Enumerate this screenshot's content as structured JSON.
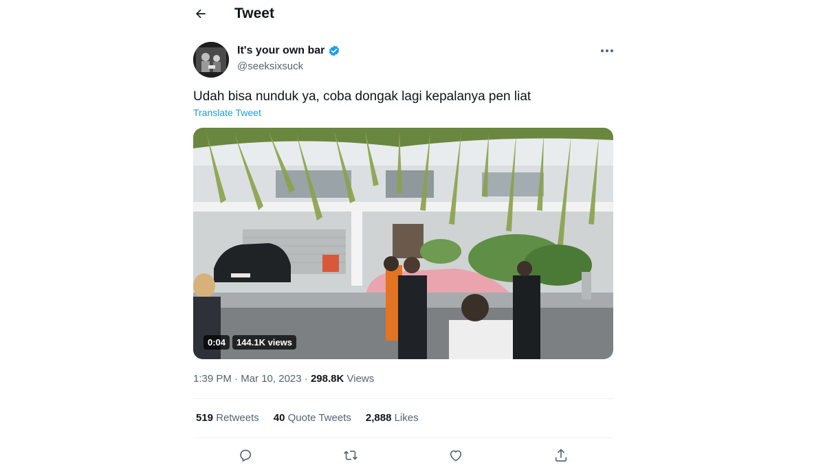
{
  "header": {
    "title": "Tweet"
  },
  "author": {
    "display_name": "It's your own bar",
    "handle": "@seeksixsuck",
    "verified": true
  },
  "tweet": {
    "text": "Udah bisa nunduk ya, coba dongak lagi kepalanya pen liat",
    "translate_label": "Translate Tweet",
    "video": {
      "duration": "0:04",
      "views_label": "144.1K views"
    },
    "time": "1:39 PM",
    "date": "Mar 10, 2023",
    "views_count": "298.8K",
    "views_label": "Views",
    "sep": "·"
  },
  "stats": {
    "retweets_count": "519",
    "retweets_label": "Retweets",
    "quotes_count": "40",
    "quotes_label": "Quote Tweets",
    "likes_count": "2,888",
    "likes_label": "Likes"
  },
  "icons": [
    "back-arrow-icon",
    "verified-badge-icon",
    "more-icon",
    "reply-icon",
    "retweet-icon",
    "like-icon",
    "share-icon"
  ],
  "colors": {
    "accent": "#1d9bf0",
    "text": "#0f1419",
    "secondary": "#536471",
    "divider": "#eff3f4"
  }
}
